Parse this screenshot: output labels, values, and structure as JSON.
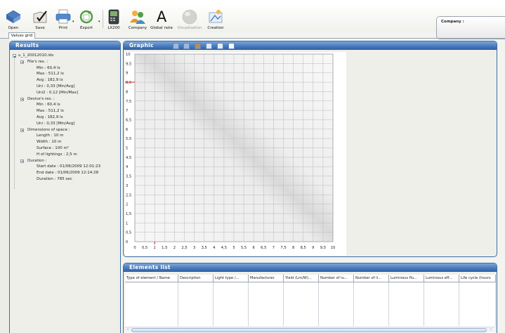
{
  "toolbar": {
    "open": "Open",
    "save": "Save",
    "print": "Print",
    "export": "Export",
    "lx200": "LX200",
    "company": "Company",
    "global_note": "Global note",
    "visualization": "Visualization",
    "creation": "Creation",
    "global_note_glyph": "A",
    "dropdown_glyph": "▾"
  },
  "company_box": {
    "label": "Company :"
  },
  "tabs": [
    {
      "label": "Values grid"
    }
  ],
  "results": {
    "title": "Results",
    "file": "u_1_20012010.ldv",
    "files_res": {
      "label": "File's res. :",
      "min": "Min : 60,4 lx",
      "max": "Max : 511,2 lx",
      "avg": "Avg : 182,9 lx",
      "uni": "Uni : 0,33 [Min/Avg]",
      "uni2": "Uni2 : 0,12 [Min/Max]"
    },
    "devices_res": {
      "label": "Device's res. :",
      "min": "Min : 60,4 lx",
      "max": "Max : 511,2 lx",
      "avg": "Avg : 182,9 lx",
      "uni": "Uni : 0,33 [Min/Avg]"
    },
    "dimensions": {
      "label": "Dimensions of space :",
      "length": "Length : 10 m",
      "width": "Width : 10 m",
      "surface": "Surface : 100 m²",
      "h_lightings": "H of lightings : 2,5 m"
    },
    "duration": {
      "label": "Duration :",
      "start": "Start date : 01/06/2009 12:01:23",
      "end": "End date : 01/06/2009 12:14:28",
      "duration": "Duration : 785 sec"
    }
  },
  "graphic": {
    "title": "Graphic",
    "tools": [
      "image-tool-icon",
      "image-tool-icon",
      "grid-color-icon",
      "dotted-grid-icon",
      "table-grid-icon",
      "chart-icon"
    ],
    "x_ticks": [
      "0",
      "0,5",
      "1",
      "1,5",
      "2",
      "2,5",
      "3",
      "3,5",
      "4",
      "4,5",
      "5",
      "5,5",
      "6",
      "6,5",
      "7",
      "7,5",
      "8",
      "8,5",
      "9",
      "9,5",
      "10"
    ],
    "y_ticks": [
      "0",
      "0,5",
      "1",
      "1,5",
      "2",
      "2,5",
      "3",
      "3,5",
      "4",
      "4,5",
      "5",
      "5,5",
      "6",
      "6,5",
      "7",
      "7,5",
      "8",
      "8,5",
      "9",
      "9,5",
      "10"
    ],
    "marker_x": 1,
    "marker_y": 8.5,
    "marker_color": "#d22020"
  },
  "elements_list": {
    "title": "Elements list",
    "columns": [
      "Type of element / Name",
      "Description",
      "Light type /...",
      "Manufacturer",
      "Yield (Lm/W)...",
      "Number of lu...",
      "Number of il...",
      "Luminous flu...",
      "Luminous eff...",
      "Life cycle (hours"
    ],
    "scroll_left": "‹",
    "scroll_right": "›"
  },
  "colors": {
    "panel_blue": "#3b6da8",
    "title_gradient_top": "#7aa6d8",
    "title_gradient_bottom": "#2f5f9f"
  }
}
